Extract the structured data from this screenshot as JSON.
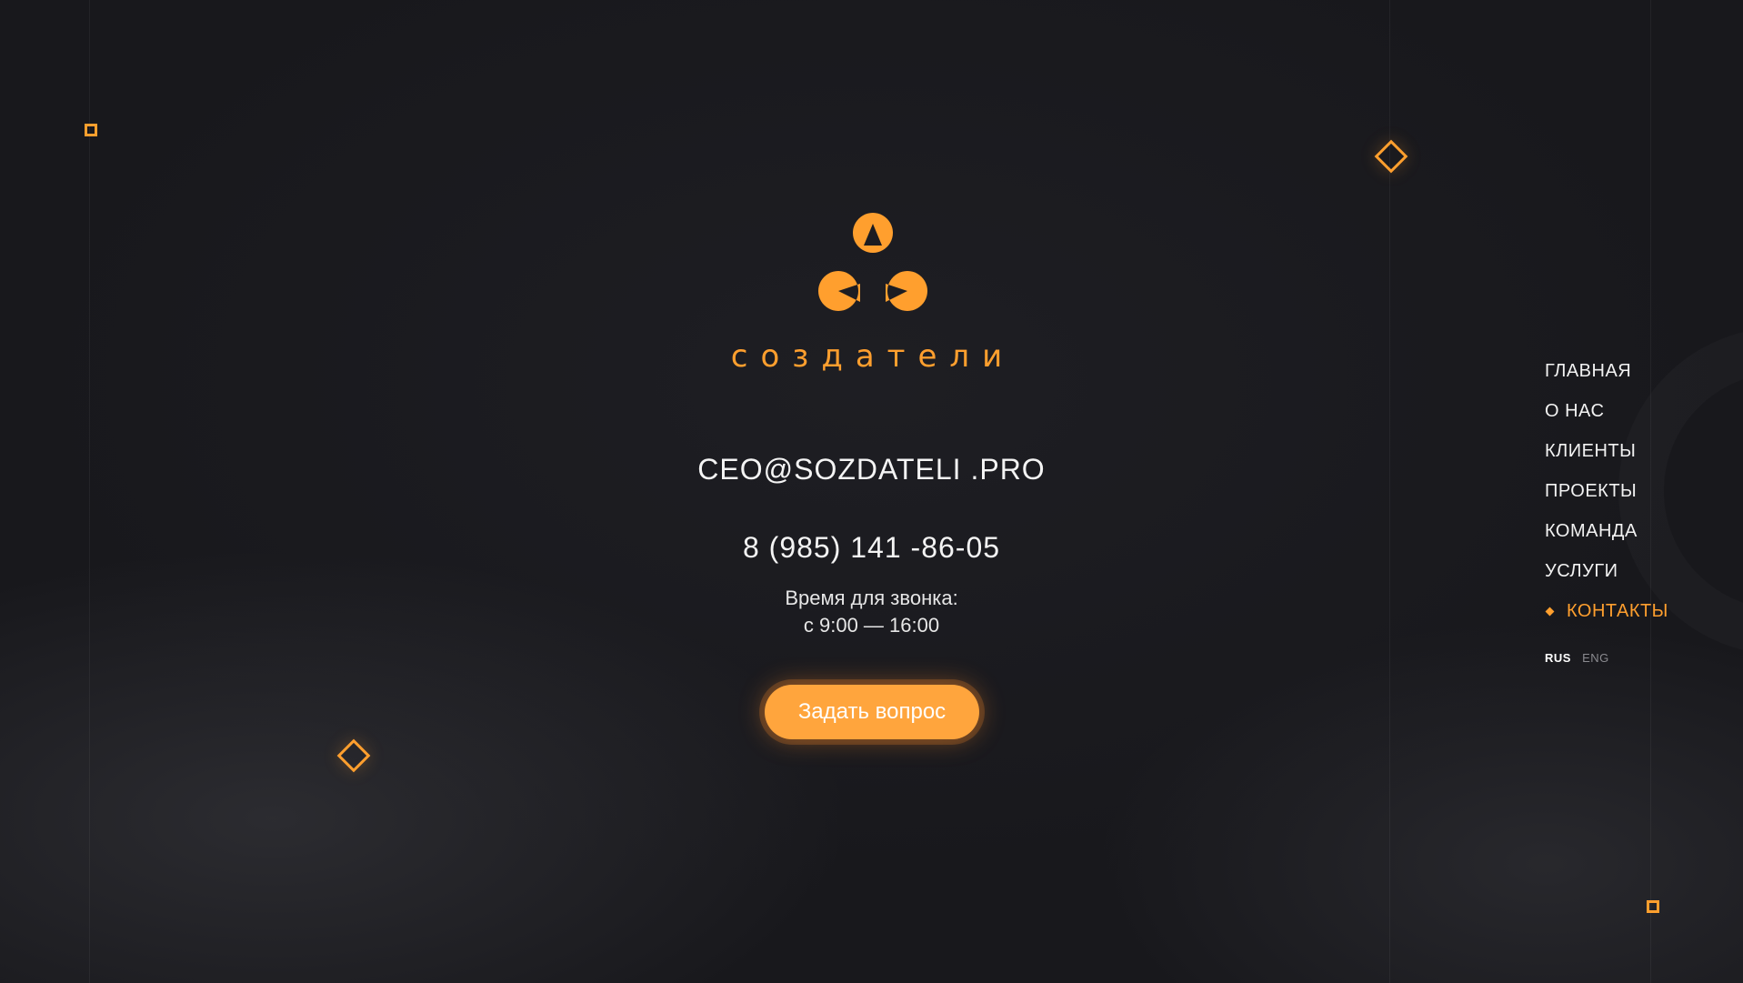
{
  "logo": {
    "icon": "three-circles-logo-icon",
    "text": "создатели"
  },
  "contact": {
    "email": "CEO@SOZDATELI .PRO",
    "phone": "8 (985) 141 -86-05",
    "hours_label": "Время для звонка:",
    "hours": "с 9:00 — 16:00",
    "ask_button_label": "Задать вопрос"
  },
  "nav": {
    "items": [
      {
        "label": "ГЛАВНАЯ"
      },
      {
        "label": "О НАС"
      },
      {
        "label": "КЛИЕНТЫ"
      },
      {
        "label": "ПРОЕКТЫ"
      },
      {
        "label": "КОМАНДА"
      },
      {
        "label": "УСЛУГИ"
      },
      {
        "label": "КОНТАКТЫ"
      }
    ],
    "active_index": 6
  },
  "lang": {
    "current": "RUS",
    "other": "ENG"
  },
  "colors": {
    "accent": "#ff9f2e",
    "background": "#1c1c21",
    "text": "#f2f2f2"
  }
}
